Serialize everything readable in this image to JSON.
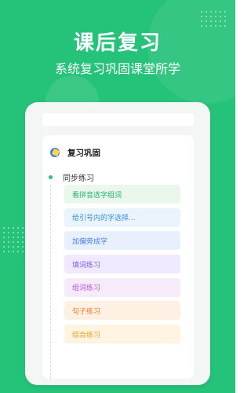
{
  "header": {
    "title": "课后复习",
    "subtitle": "系统复习巩固课堂所学"
  },
  "panel": {
    "section_title": "复习巩固",
    "subsection_title": "同步练习",
    "items": [
      {
        "label": "看拼音选字组词",
        "bg": "#e9f7ec",
        "color": "#29b36a"
      },
      {
        "label": "给引号内的字选择...",
        "bg": "#e9f4fd",
        "color": "#3b8fe1"
      },
      {
        "label": "加偏旁成字",
        "bg": "#e8f0fe",
        "color": "#4c7fe8"
      },
      {
        "label": "填词练习",
        "bg": "#efeaff",
        "color": "#7b64e6"
      },
      {
        "label": "组词练习",
        "bg": "#f6ebfb",
        "color": "#b45bd9"
      },
      {
        "label": "句子练习",
        "bg": "#fff0e4",
        "color": "#f07d2c"
      },
      {
        "label": "综合练习",
        "bg": "#fff4e1",
        "color": "#f2a21c"
      }
    ]
  },
  "colors": {
    "background": "#25c27a"
  }
}
